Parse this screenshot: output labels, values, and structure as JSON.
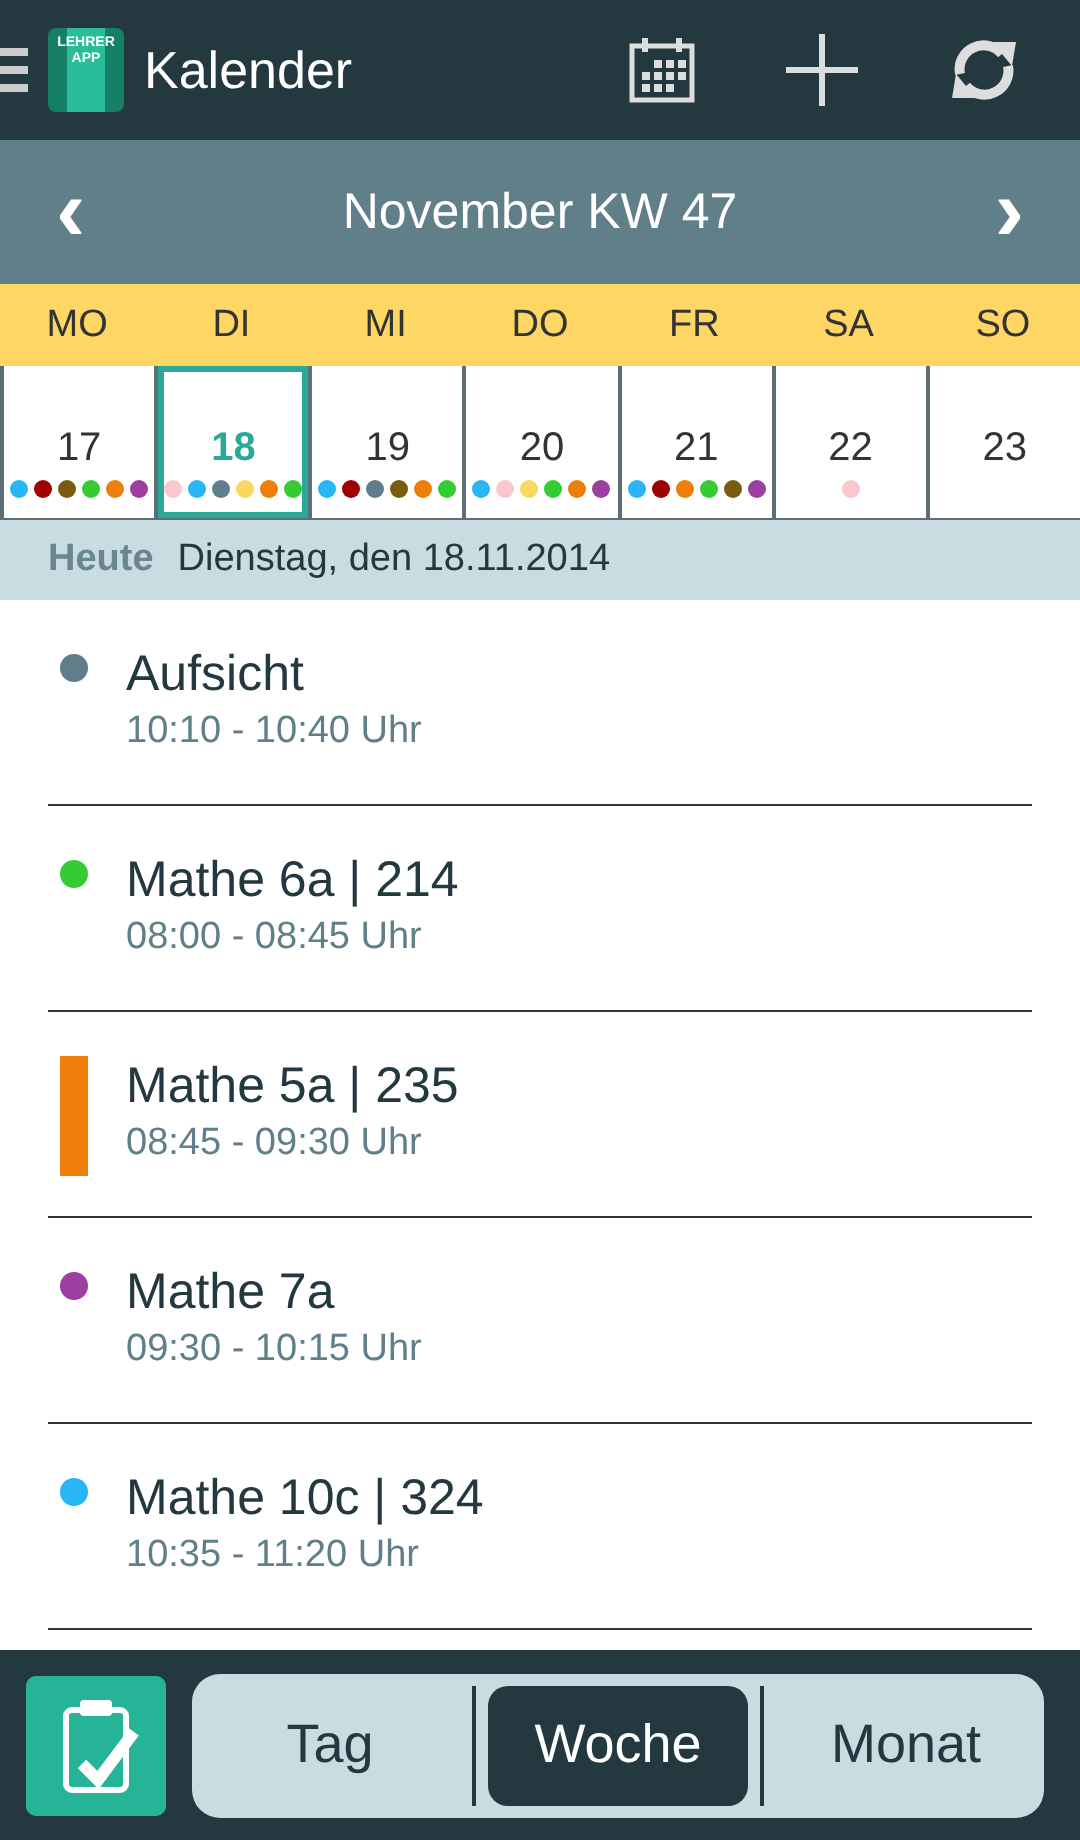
{
  "header": {
    "logo_lines": [
      "LEHRER",
      "APP"
    ],
    "title": "Kalender"
  },
  "week_nav": {
    "prev": "‹",
    "label": "November KW 47",
    "next": "›"
  },
  "weekdays": [
    "MO",
    "DI",
    "MI",
    "DO",
    "FR",
    "SA",
    "SO"
  ],
  "days": [
    {
      "date": "17",
      "selected": false,
      "dots": [
        {
          "color": "#29b6f6"
        },
        {
          "color": "#a00000"
        },
        {
          "color": "#7a5c10"
        },
        {
          "color": "#33cc33"
        },
        {
          "color": "#ee7d0a"
        },
        {
          "color": "#9c3fa0"
        }
      ]
    },
    {
      "date": "18",
      "selected": true,
      "dots": [
        {
          "color": "#f8c8cc"
        },
        {
          "color": "#29b6f6"
        },
        {
          "color": "#607d8b"
        },
        {
          "color": "#f8d860"
        },
        {
          "color": "#ee7d0a"
        },
        {
          "color": "#33cc33"
        }
      ]
    },
    {
      "date": "19",
      "selected": false,
      "dots": [
        {
          "color": "#29b6f6"
        },
        {
          "color": "#a00000"
        },
        {
          "color": "#607d8b"
        },
        {
          "color": "#7a5c10"
        },
        {
          "color": "#ee7d0a"
        },
        {
          "color": "#33cc33"
        }
      ]
    },
    {
      "date": "20",
      "selected": false,
      "dots": [
        {
          "color": "#29b6f6"
        },
        {
          "color": "#f8c8cc"
        },
        {
          "color": "#f8d860"
        },
        {
          "color": "#33cc33"
        },
        {
          "color": "#ee7d0a"
        },
        {
          "color": "#9c3fa0"
        }
      ]
    },
    {
      "date": "21",
      "selected": false,
      "dots": [
        {
          "color": "#29b6f6"
        },
        {
          "color": "#a00000"
        },
        {
          "color": "#ee7d0a"
        },
        {
          "color": "#33cc33"
        },
        {
          "color": "#7a5c10"
        },
        {
          "color": "#9c3fa0"
        }
      ]
    },
    {
      "date": "22",
      "selected": false,
      "dots": [
        {
          "color": "#f8c8cc"
        }
      ]
    },
    {
      "date": "23",
      "selected": false
    }
  ],
  "today_bar": {
    "label": "Heute",
    "date": "Dienstag, den 18.11.2014"
  },
  "events": [
    {
      "title": "Aufsicht",
      "time": "10:10 - 10:40 Uhr",
      "kind": "dot",
      "color": "#607d8b"
    },
    {
      "title": "Mathe 6a | 214",
      "time": "08:00 - 08:45 Uhr",
      "kind": "dot",
      "color": "#33cc33"
    },
    {
      "title": "Mathe 5a | 235",
      "time": "08:45 - 09:30 Uhr",
      "kind": "bar",
      "color": "#ee7d0a"
    },
    {
      "title": "Mathe 7a",
      "time": "09:30 - 10:15 Uhr",
      "kind": "dot",
      "color": "#9c3fa0"
    },
    {
      "title": "Mathe 10c | 324",
      "time": "10:35 - 11:20 Uhr",
      "kind": "dot",
      "color": "#29b6f6"
    }
  ],
  "view_tabs": [
    {
      "label": "Tag",
      "selected": false
    },
    {
      "label": "Woche",
      "selected": true
    },
    {
      "label": "Monat",
      "selected": false
    }
  ]
}
